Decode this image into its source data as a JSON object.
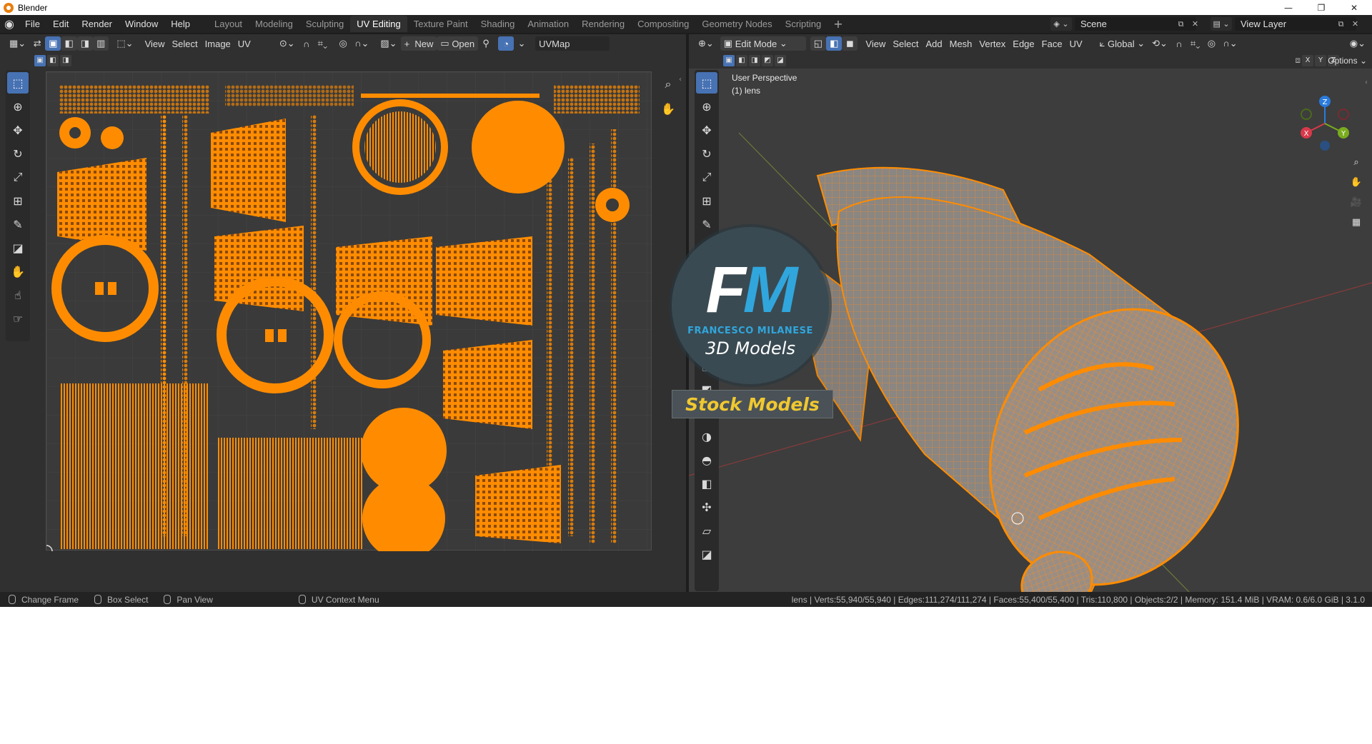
{
  "window": {
    "title": "Blender",
    "controls": [
      "—",
      "❐",
      "✕"
    ]
  },
  "menubar": {
    "items": [
      "File",
      "Edit",
      "Render",
      "Window",
      "Help"
    ],
    "workspaces": [
      "Layout",
      "Modeling",
      "Sculpting",
      "UV Editing",
      "Texture Paint",
      "Shading",
      "Animation",
      "Rendering",
      "Compositing",
      "Geometry Nodes",
      "Scripting"
    ],
    "active_workspace": "UV Editing",
    "scene": "Scene",
    "view_layer": "View Layer"
  },
  "uv_editor": {
    "header": {
      "menus": [
        "View",
        "Select",
        "Image",
        "UV"
      ],
      "new_label": "New",
      "open_label": "Open",
      "uvmap": "UVMap"
    }
  },
  "viewport": {
    "header": {
      "mode": "Edit Mode",
      "menus": [
        "View",
        "Select",
        "Add",
        "Mesh",
        "Vertex",
        "Edge",
        "Face",
        "UV"
      ],
      "orientation": "Global",
      "options": "Options",
      "axes": [
        "X",
        "Y",
        "Z"
      ]
    },
    "overlay": {
      "perspective": "User Perspective",
      "object": "(1) lens"
    },
    "gizmo": {
      "x": "X",
      "y": "Y",
      "z": "Z"
    }
  },
  "watermark": {
    "fm_f": "F",
    "fm_m": "M",
    "name": "FRANCESCO MILANESE",
    "tagline": "3D Models",
    "stock": "Stock Models"
  },
  "statusbar": {
    "items": [
      "Change Frame",
      "Box Select",
      "Pan View",
      "UV Context Menu"
    ],
    "stats": "lens | Verts:55,940/55,940 | Edges:111,274/111,274 | Faces:55,400/55,400 | Tris:110,800 | Objects:2/2 | Memory: 151.4 MiB | VRAM: 0.6/6.0 GiB | 3.1.0"
  },
  "colors": {
    "accent": "#4772b3",
    "uv_orange": "#ff8c00",
    "mesh_orange": "#e87d0d",
    "background": "#303030"
  }
}
